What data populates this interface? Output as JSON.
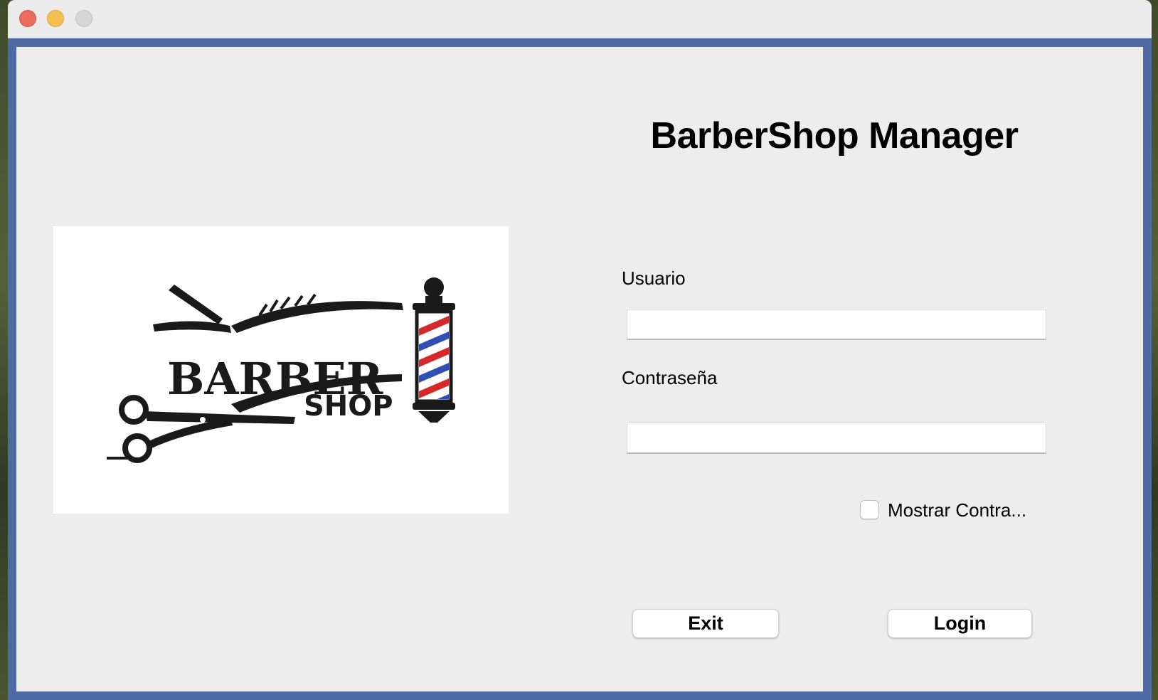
{
  "window": {
    "controls": [
      "close-button",
      "minimize-button",
      "zoom-button"
    ]
  },
  "app": {
    "title": "BarberShop Manager"
  },
  "logo": {
    "line1": "BARBER",
    "line2": "SHOP",
    "pole_colors": [
      "#d62828",
      "#ffffff",
      "#2f4fb5"
    ],
    "icons": [
      "razor-icon",
      "scissors-icon",
      "barber-pole-icon"
    ]
  },
  "form": {
    "user_label": "Usuario",
    "user_value": "",
    "password_label": "Contraseña",
    "password_value": "",
    "show_password_label": "Mostrar Contra...",
    "show_password_checked": false
  },
  "buttons": {
    "exit_label": "Exit",
    "login_label": "Login"
  },
  "colors": {
    "window_border": "#4f6ba3",
    "content_bg": "#ededed"
  }
}
